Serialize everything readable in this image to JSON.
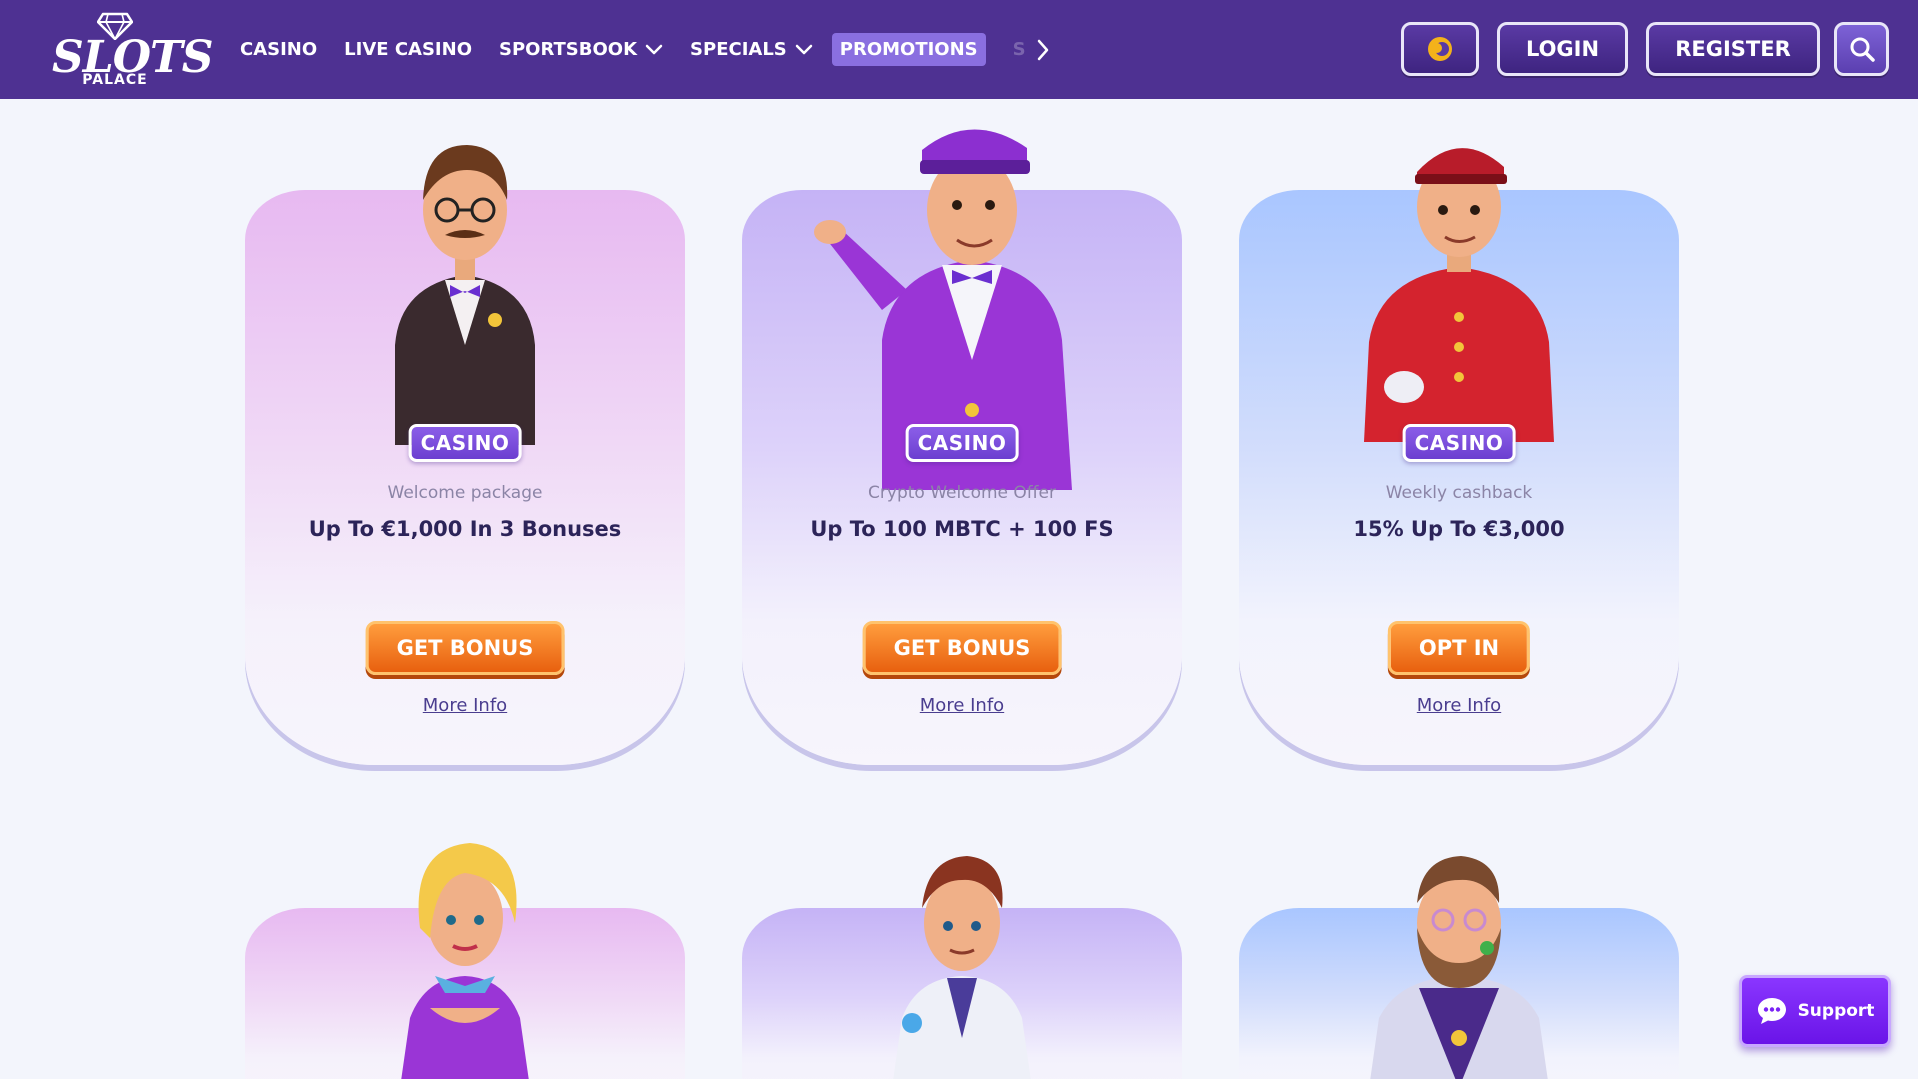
{
  "brand": {
    "word": "SLOTS",
    "sub": "PALACE"
  },
  "nav": {
    "items": [
      {
        "label": "CASINO"
      },
      {
        "label": "LIVE CASINO"
      },
      {
        "label": "SPORTSBOOK"
      },
      {
        "label": "SPECIALS"
      },
      {
        "label": "PROMOTIONS"
      },
      {
        "label": "S"
      }
    ]
  },
  "header": {
    "login_label": "LOGIN",
    "register_label": "REGISTER"
  },
  "promos": [
    {
      "badge": "CASINO",
      "subtitle": "Welcome package",
      "title": "Up To €1,000 In 3 Bonuses",
      "cta": "GET BONUS",
      "more": "More Info"
    },
    {
      "badge": "CASINO",
      "subtitle": "Crypto Welcome Offer",
      "title": "Up To 100 MBTC + 100 FS",
      "cta": "GET BONUS",
      "more": "More Info"
    },
    {
      "badge": "CASINO",
      "subtitle": "Weekly cashback",
      "title": "15% Up To €3,000",
      "cta": "OPT IN",
      "more": "More Info"
    }
  ],
  "support": {
    "label": "Support"
  },
  "colors": {
    "header_bg": "#4e3192",
    "active_tab": "#8a6fe0",
    "badge": "#7a4ddc",
    "cta": "#f17a1e",
    "support": "#7a22f5"
  },
  "icons": [
    "diamond-logo-icon",
    "chevron-down-icon",
    "chevron-right-icon",
    "coin-icon",
    "search-icon",
    "chat-bubble-icon"
  ]
}
